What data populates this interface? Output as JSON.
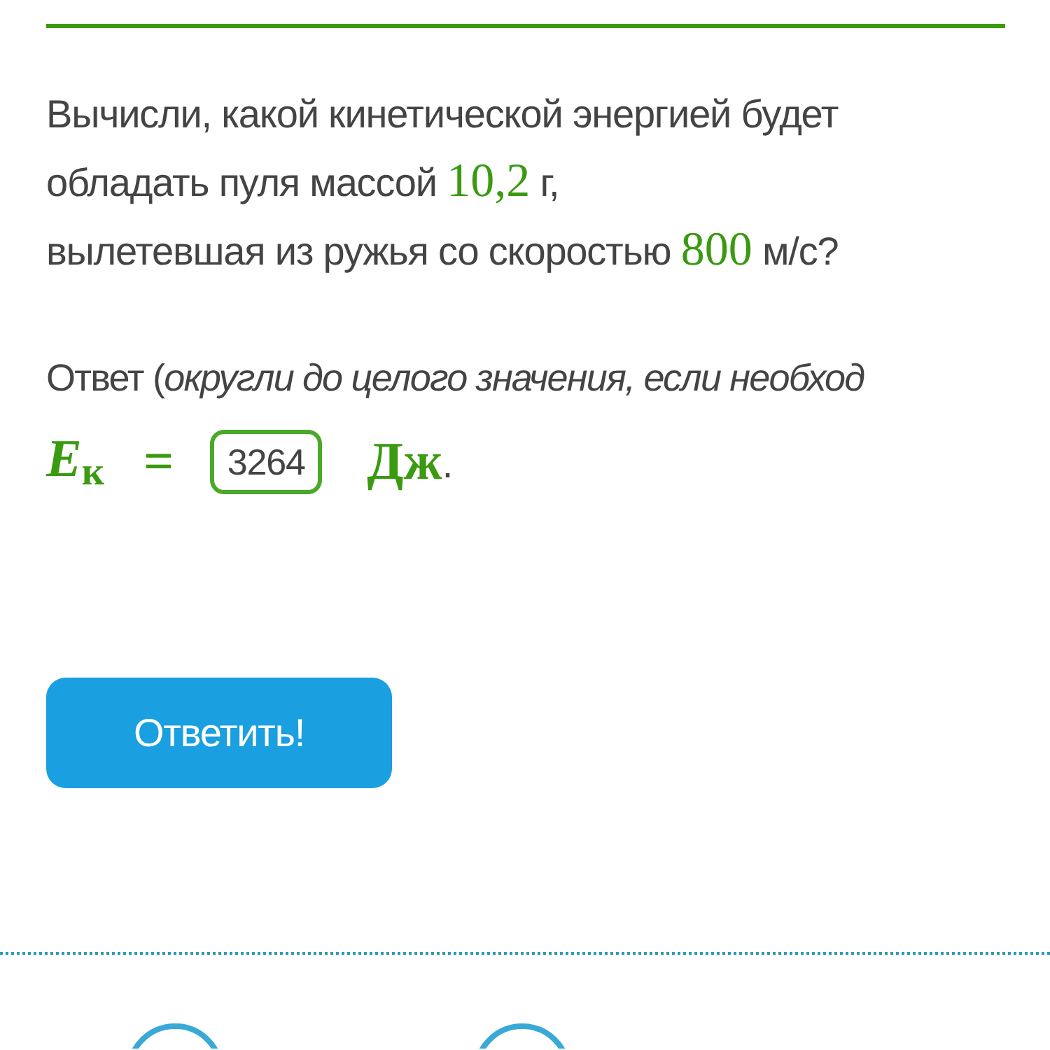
{
  "question": {
    "lines": [
      [
        {
          "kind": "text",
          "text": "Вычисли, какой кинетической энергией будет"
        }
      ],
      [
        {
          "kind": "text",
          "text": "обладать пуля массой "
        },
        {
          "kind": "value",
          "text": "10,2"
        },
        {
          "kind": "text",
          "text": " г,"
        }
      ],
      [
        {
          "kind": "text",
          "text": "вылетевшая из ружья со скоростью "
        },
        {
          "kind": "value",
          "text": "800"
        },
        {
          "kind": "text",
          "text": " м/с?"
        }
      ]
    ]
  },
  "instruction": "Ответ (*округли до целого значения, если необход*",
  "answer": {
    "symbol": "E",
    "subscript": "к",
    "equals": "=",
    "value": "3264",
    "unit": "Дж",
    "end": "."
  },
  "submit_button": "Ответить!"
}
